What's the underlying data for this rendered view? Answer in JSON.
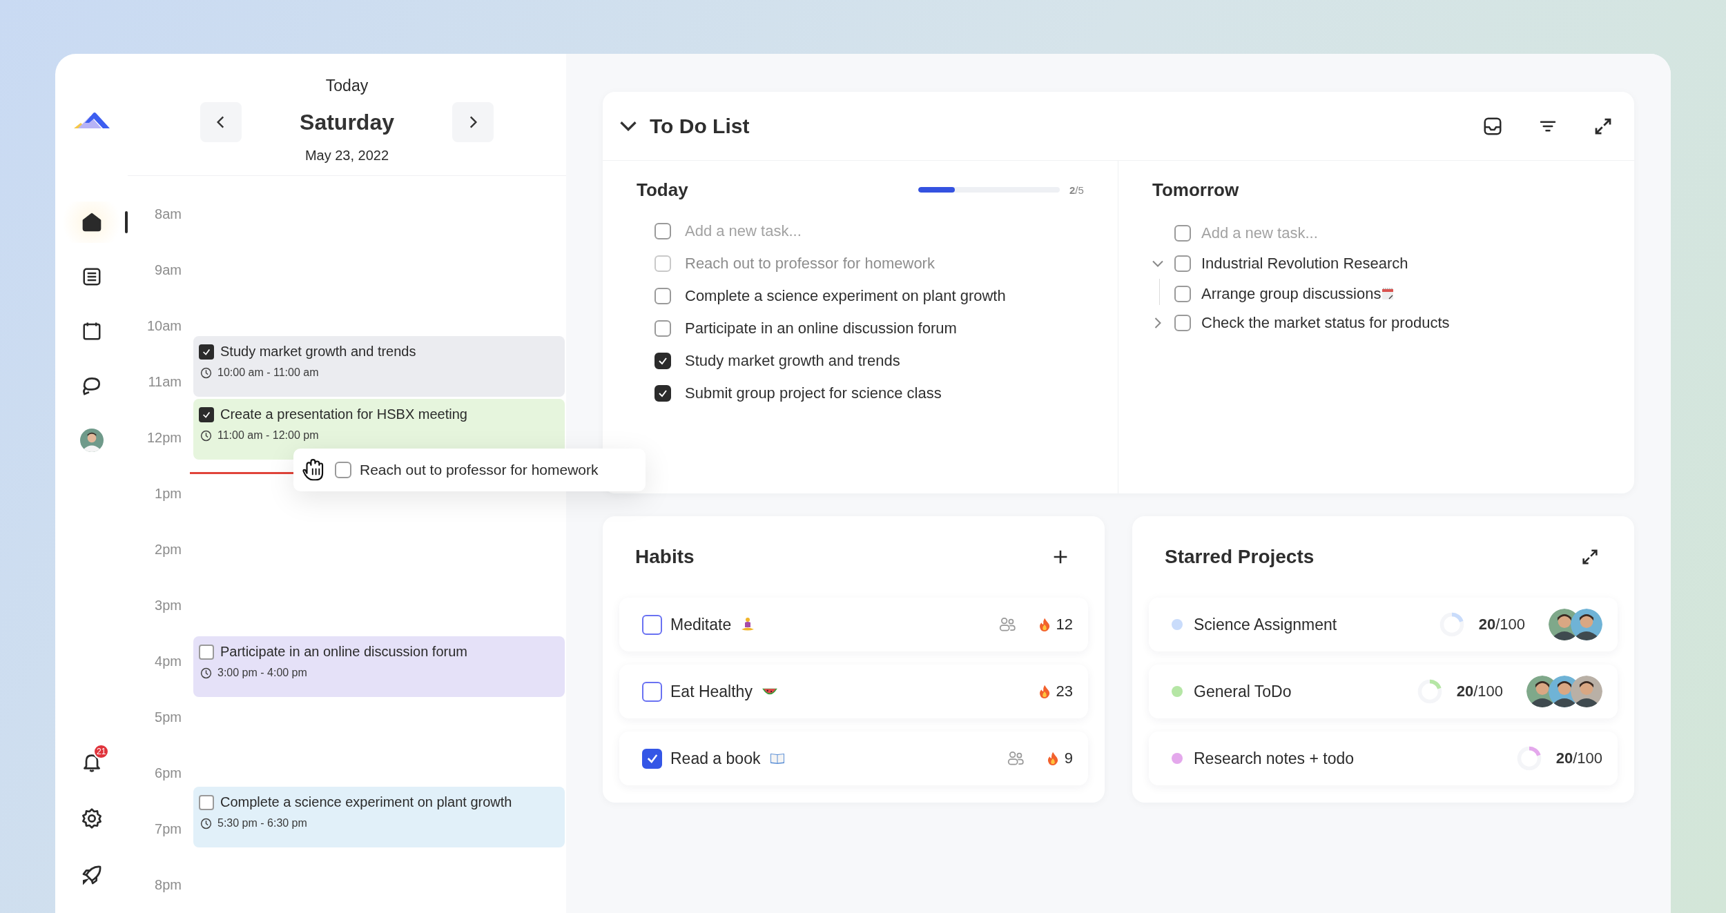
{
  "sidebar": {
    "items": [
      {
        "kind": "home",
        "selected": true
      },
      {
        "kind": "list",
        "selected": false
      },
      {
        "kind": "calendar",
        "selected": false
      },
      {
        "kind": "chat",
        "selected": false
      },
      {
        "kind": "avatar",
        "selected": false
      }
    ],
    "bottom": [
      {
        "kind": "bell",
        "badge": "21"
      },
      {
        "kind": "gear"
      },
      {
        "kind": "rocket"
      }
    ]
  },
  "calendar": {
    "label": "Today",
    "day": "Saturday",
    "date": "May 23, 2022",
    "hours": [
      "8am",
      "9am",
      "10am",
      "11am",
      "12pm",
      "1pm",
      "2pm",
      "3pm",
      "4pm",
      "5pm",
      "6pm",
      "7pm",
      "8pm"
    ],
    "events": [
      {
        "title": "Study market growth and trends",
        "time": "10:00 am - 11:00 am",
        "checked": true,
        "color": "#ebecf0"
      },
      {
        "title": "Create a presentation for HSBX meeting",
        "time": "11:00 am - 12:00 pm",
        "checked": true,
        "color": "#e6f5dd"
      },
      {
        "title": "Participate in an online discussion forum",
        "time": "3:00 pm - 4:00 pm",
        "checked": false,
        "color": "#e5e1f8"
      },
      {
        "title": "Complete a science experiment on plant growth",
        "time": "5:30 pm - 6:30 pm",
        "checked": false,
        "color": "#e1f0f9"
      }
    ],
    "drag_item": {
      "title": "Reach out to professor for homework",
      "checked": false
    }
  },
  "todo": {
    "title": "To Do List",
    "expanded": true,
    "today": {
      "title": "Today",
      "level": 0.26,
      "progress": "**2**/5",
      "new_task": {
        "placeholder": "Add a new task...",
        "checked": false
      },
      "tasks": [
        {
          "text": "Reach out to professor for homework",
          "checked": false,
          "dragging": true
        },
        {
          "text": "Complete a science experiment on plant growth",
          "checked": false,
          "dragging": false
        },
        {
          "text": "Participate in an online discussion forum",
          "checked": false,
          "dragging": false
        },
        {
          "text": "Study market growth and trends",
          "checked": true,
          "dragging": false
        },
        {
          "text": "Submit group project for science class",
          "checked": true,
          "dragging": false
        }
      ]
    },
    "tomorrow": {
      "title": "Tomorrow",
      "new_task": {
        "placeholder": "Add a new task...",
        "checked": false
      },
      "tasks": [
        {
          "text": "Industrial Revolution Research",
          "checked": false,
          "expanded": true,
          "children": [
            {
              "text": "Arrange group discussions",
              "checked": false,
              "kind": "notepad"
            }
          ]
        },
        {
          "text": "Check the market status for products",
          "checked": false,
          "expanded": false
        }
      ]
    }
  },
  "habits": {
    "title": "Habits",
    "items": [
      {
        "name": "Meditate",
        "kind": "meditation",
        "checked": false,
        "shared": true,
        "streak": "12"
      },
      {
        "name": "Eat Healthy",
        "kind": "watermelon",
        "checked": false,
        "shared": false,
        "streak": "23"
      },
      {
        "name": "Read a book",
        "kind": "book",
        "checked": true,
        "shared": true,
        "streak": "9"
      }
    ]
  },
  "starred": {
    "title": "Starred Projects",
    "projects": [
      {
        "name": "Science Assignment",
        "color": "#c9dcfb",
        "level": 0.2,
        "progress": "**20**/100",
        "members": [
          {
            "kind": "picture"
          },
          {
            "kind": "picture"
          }
        ]
      },
      {
        "name": "General ToDo",
        "color": "#b5e6a5",
        "level": 0.2,
        "progress": "**20**/100",
        "members": [
          {
            "kind": "picture"
          },
          {
            "kind": "picture"
          },
          {
            "kind": "picture"
          }
        ]
      },
      {
        "name": "Research notes + todo",
        "color": "#e4a8ec",
        "level": 0.2,
        "progress": "**20**/100"
      }
    ]
  }
}
